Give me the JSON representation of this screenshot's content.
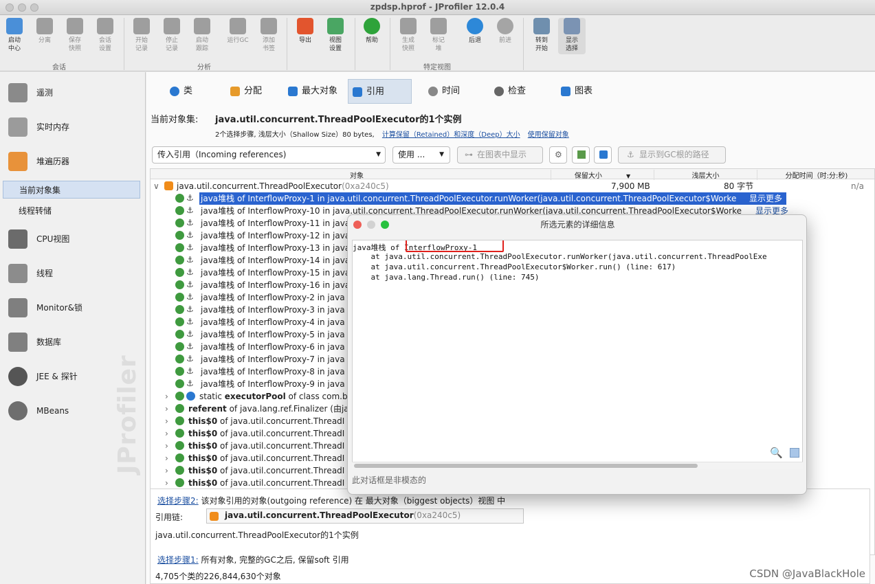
{
  "window": {
    "title": "zpdsp.hprof - JProfiler 12.0.4"
  },
  "toolbar": {
    "buttons": [
      {
        "l1": "启动",
        "l2": "中心"
      },
      {
        "l1": "分离",
        "l2": ""
      },
      {
        "l1": "保存",
        "l2": "快照"
      },
      {
        "l1": "会话",
        "l2": "设置"
      },
      {
        "l1": "开始",
        "l2": "记录"
      },
      {
        "l1": "停止",
        "l2": "记录"
      },
      {
        "l1": "启动",
        "l2": "跟踪"
      },
      {
        "l1": "运行GC",
        "l2": ""
      },
      {
        "l1": "添加",
        "l2": "书签"
      },
      {
        "l1": "导出",
        "l2": ""
      },
      {
        "l1": "视图",
        "l2": "设置"
      },
      {
        "l1": "帮助",
        "l2": ""
      },
      {
        "l1": "生成",
        "l2": "快照"
      },
      {
        "l1": "标记",
        "l2": "堆"
      },
      {
        "l1": "后退",
        "l2": ""
      },
      {
        "l1": "前进",
        "l2": ""
      },
      {
        "l1": "转到",
        "l2": "开始"
      },
      {
        "l1": "显示",
        "l2": "选择"
      }
    ],
    "groups": {
      "session": "会话",
      "analysis": "分析",
      "views": "特定视图"
    }
  },
  "sidebar": {
    "items": [
      "遥测",
      "实时内存",
      "堆遍历器",
      "CPU视图",
      "线程",
      "Monitor&锁",
      "数据库",
      "JEE & 探针",
      "MBeans"
    ],
    "sub": [
      "当前对象集",
      "线程转储"
    ],
    "watermark": "JProfiler"
  },
  "tabs": [
    "类",
    "分配",
    "最大对象",
    "引用",
    "时间",
    "检查",
    "图表"
  ],
  "objset": {
    "label": "当前对象集:",
    "value": "java.util.concurrent.ThreadPoolExecutor的1个实例",
    "info": "2个选择步骤, 浅层大小（Shallow Size）80 bytes,",
    "link1": "计算保留（Retained）和深度（Deep）大小",
    "link2": "使用保留对象"
  },
  "controls": {
    "dropdown": "传入引用（Incoming references)",
    "use": "使用 ...",
    "graph": "在图表中显示",
    "gcpath": "显示到GC根的路径"
  },
  "table": {
    "headers": [
      "对象",
      "保留大小",
      "浅层大小",
      "分配时间（时:分:秒)"
    ],
    "root": {
      "name": "java.util.concurrent.ThreadPoolExecutor",
      "id": "(0xa240c5)",
      "retained": "7,900 MB",
      "shallow": "80 字节",
      "time": "n/a"
    },
    "row1": "java堆栈 of InterflowProxy-1 in java.util.concurrent.ThreadPoolExecutor.runWorker(java.util.concurrent.ThreadPoolExecutor$Worke",
    "row2": "java堆栈 of InterflowProxy-10 in java.util.concurrent.ThreadPoolExecutor.runWorker(java.util.concurrent.ThreadPoolExecutor$Worke",
    "showmore": "显示更多",
    "proxies": [
      "java堆栈 of InterflowProxy-11 in java",
      "java堆栈 of InterflowProxy-12 in java",
      "java堆栈 of InterflowProxy-13 in java",
      "java堆栈 of InterflowProxy-14 in java",
      "java堆栈 of InterflowProxy-15 in java",
      "java堆栈 of InterflowProxy-16 in java",
      "java堆栈 of InterflowProxy-2 in java",
      "java堆栈 of InterflowProxy-3 in java",
      "java堆栈 of InterflowProxy-4 in java",
      "java堆栈 of InterflowProxy-5 in java",
      "java堆栈 of InterflowProxy-6 in java",
      "java堆栈 of InterflowProxy-7 in java",
      "java堆栈 of InterflowProxy-8 in java",
      "java堆栈 of InterflowProxy-9 in java"
    ],
    "refs": [
      {
        "pre": "static ",
        "bold": "executorPool",
        "rest": " of class com.b"
      },
      {
        "pre": "",
        "bold": "referent",
        "rest": " of java.lang.ref.Finalizer (由ja"
      },
      {
        "pre": "",
        "bold": "this$0",
        "rest": " of java.util.concurrent.ThreadI"
      },
      {
        "pre": "",
        "bold": "this$0",
        "rest": " of java.util.concurrent.ThreadI"
      },
      {
        "pre": "",
        "bold": "this$0",
        "rest": " of java.util.concurrent.ThreadI"
      },
      {
        "pre": "",
        "bold": "this$0",
        "rest": " of java.util.concurrent.ThreadI"
      },
      {
        "pre": "",
        "bold": "this$0",
        "rest": " of java.util.concurrent.ThreadI"
      },
      {
        "pre": "",
        "bold": "this$0",
        "rest": " of java.util.concurrent.ThreadI"
      }
    ]
  },
  "bottom": {
    "step2_link": "选择步骤2:",
    "step2_text": "该对象引用的对象(outgoing reference) 在 最大对象（biggest objects）视图 中",
    "chain_label": "引用链:",
    "chain_value": "java.util.concurrent.ThreadPoolExecutor",
    "chain_id": "(0xa240c5)",
    "instances": "java.util.concurrent.ThreadPoolExecutor的1个实例",
    "step1_link": "选择步骤1:",
    "step1_text": "所有对象, 完整的GC之后, 保留soft 引用",
    "count": "4,705个类的226,844,630个对象"
  },
  "dialog": {
    "title": "所选元素的详细信息",
    "prefix": "java堆栈 of ",
    "thread": "InterflowProxy-1",
    "lines": [
      "    at java.util.concurrent.ThreadPoolExecutor.runWorker(java.util.concurrent.ThreadPoolExe",
      "    at java.util.concurrent.ThreadPoolExecutor$Worker.run() (line: 617)",
      "    at java.lang.Thread.run() (line: 745)"
    ],
    "footer": "此对话框是非模态的"
  },
  "watermark": "CSDN @JavaBlackHole"
}
